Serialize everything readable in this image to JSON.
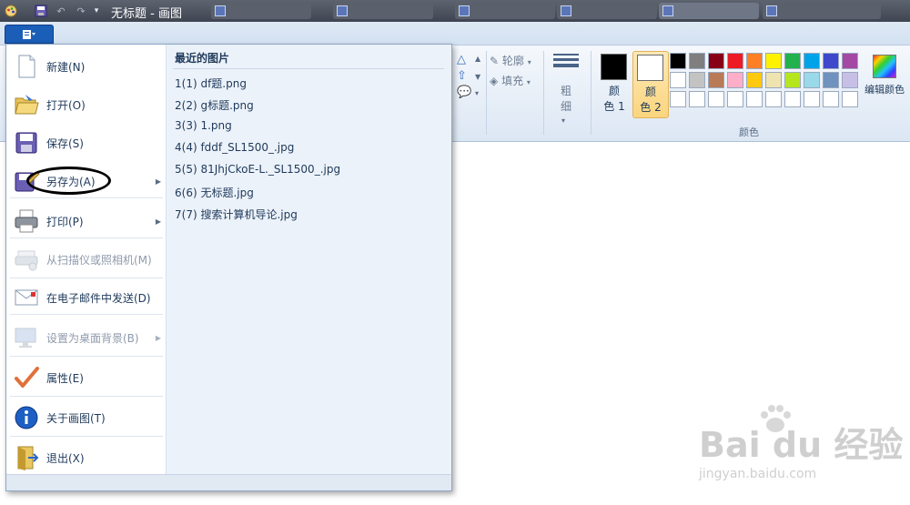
{
  "window": {
    "title": "无标题 - 画图",
    "taskbar_tabs": [
      "",
      "",
      "",
      "",
      "",
      ""
    ]
  },
  "ribbon": {
    "outline_label": "轮廓",
    "fill_label": "填充",
    "size_label": "粗\n细",
    "color1_label": "颜\n色 1",
    "color2_label": "颜\n色 2",
    "colors_group_label": "颜色",
    "edit_colors_label": "编辑颜色",
    "color1_value": "#000000",
    "color2_value": "#ffffff",
    "palette": [
      "#000000",
      "#7f7f7f",
      "#880015",
      "#ed1c24",
      "#ff7f27",
      "#fff200",
      "#22b14c",
      "#00a2e8",
      "#3f48cc",
      "#a349a4",
      "#ffffff",
      "#c3c3c3",
      "#b97a57",
      "#ffaec9",
      "#ffc90e",
      "#efe4b0",
      "#b5e61d",
      "#99d9ea",
      "#7092be",
      "#c8bfe7",
      "#ffffff",
      "#ffffff",
      "#ffffff",
      "#ffffff",
      "#ffffff",
      "#ffffff",
      "#ffffff",
      "#ffffff",
      "#ffffff",
      "#ffffff"
    ]
  },
  "file_menu": {
    "items": [
      {
        "label": "新建(N)",
        "icon": "new-document-icon",
        "disabled": false,
        "submenu": false
      },
      {
        "label": "打开(O)",
        "icon": "open-folder-icon",
        "disabled": false,
        "submenu": false
      },
      {
        "label": "保存(S)",
        "icon": "save-disk-icon",
        "disabled": false,
        "submenu": false
      },
      {
        "label": "另存为(A)",
        "icon": "save-as-icon",
        "disabled": false,
        "submenu": true
      },
      {
        "label": "打印(P)",
        "icon": "printer-icon",
        "disabled": false,
        "submenu": true
      },
      {
        "label": "从扫描仪或照相机(M)",
        "icon": "scanner-icon",
        "disabled": true,
        "submenu": false
      },
      {
        "label": "在电子邮件中发送(D)",
        "icon": "email-icon",
        "disabled": false,
        "submenu": false
      },
      {
        "label": "设置为桌面背景(B)",
        "icon": "desktop-icon",
        "disabled": true,
        "submenu": true
      },
      {
        "label": "属性(E)",
        "icon": "checkmark-icon",
        "disabled": false,
        "submenu": false
      },
      {
        "label": "关于画图(T)",
        "icon": "info-icon",
        "disabled": false,
        "submenu": false
      },
      {
        "label": "退出(X)",
        "icon": "exit-icon",
        "disabled": false,
        "submenu": false
      }
    ],
    "recent_header": "最近的图片",
    "recent_files": [
      "1(1)  df题.png",
      "2(2)  g标题.png",
      "3(3)  1.png",
      "4(4)  fddf_SL1500_.jpg",
      "5(5)  81JhjCkoE-L._SL1500_.jpg",
      "6(6)  无标题.jpg",
      "7(7)  搜索计算机导论.jpg"
    ]
  },
  "watermark": {
    "logo": "Bai du 经验",
    "url": "jingyan.baidu.com"
  }
}
